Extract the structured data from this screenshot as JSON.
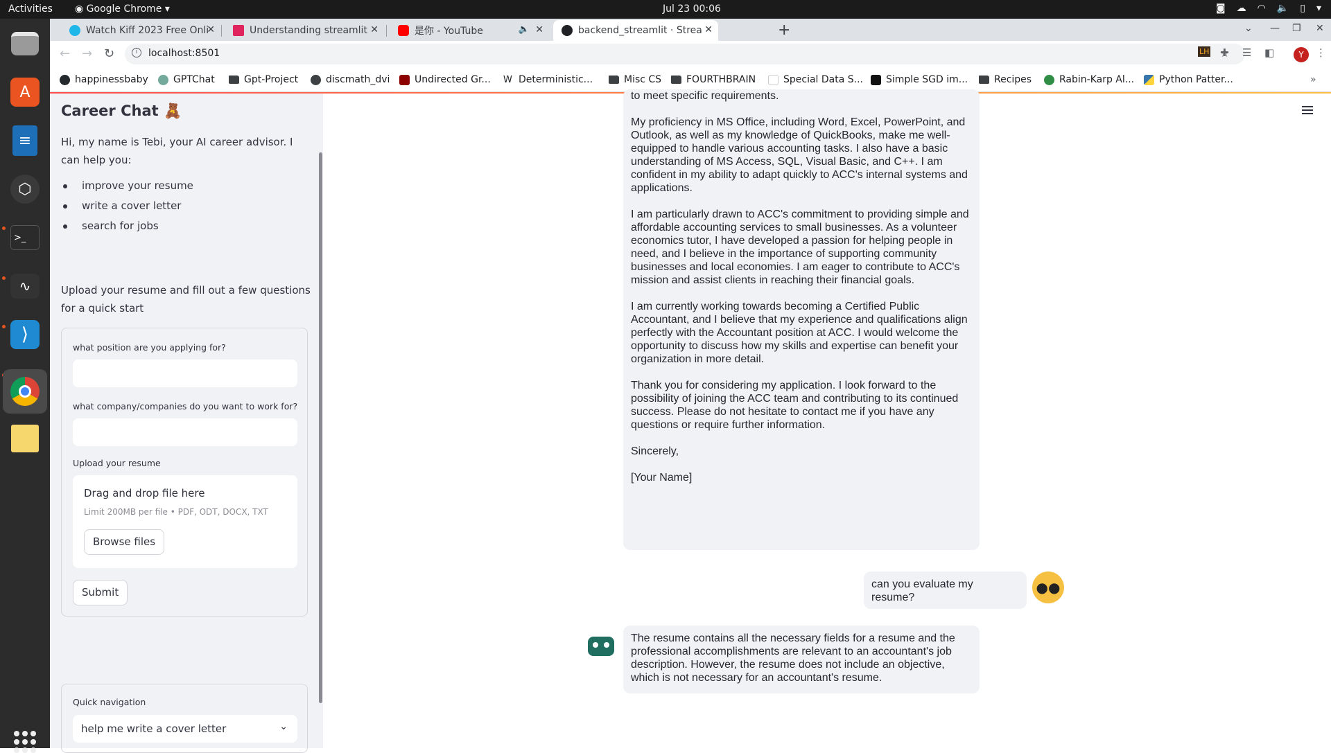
{
  "os": {
    "activities": "Activities",
    "app_name": "Google Chrome",
    "clock": "Jul 23  00:06"
  },
  "browser": {
    "tabs": [
      {
        "title": "Watch Kiff 2023 Free Onli",
        "favicon_color": "#1fb6e8"
      },
      {
        "title": "Understanding streamlit",
        "favicon_color": "#e0245e"
      },
      {
        "title": "是你 - YouTube",
        "favicon_color": "#ff0000"
      },
      {
        "title": "backend_streamlit · Strea",
        "favicon_color": "#202124"
      }
    ],
    "url": "localhost:8501",
    "profile_initial": "Y",
    "bookmarks": [
      "happinessbaby",
      "GPTChat",
      "Gpt-Project",
      "discmath_dvi",
      "Undirected Gr...",
      "Deterministic...",
      "Misc CS",
      "FOURTHBRAIN",
      "Special Data S...",
      "Simple SGD im...",
      "Recipes",
      "Rabin-Karp Al...",
      "Python Patter..."
    ]
  },
  "sidebar": {
    "title": "Career Chat 🧸",
    "intro": "Hi, my name is Tebi, your AI career advisor. I can help you:",
    "items": [
      "improve your resume",
      "write a cover letter",
      "search for jobs"
    ],
    "upload_prompt": "Upload your resume and fill out a few questions for a quick start",
    "form": {
      "position_label": "what position are you applying for?",
      "position_value": "",
      "company_label": "what company/companies do you want to work for?",
      "company_value": "",
      "resume_label": "Upload your resume",
      "dropzone_title": "Drag and drop file here",
      "dropzone_limit": "Limit 200MB per file • PDF, ODT, DOCX, TXT",
      "browse_label": "Browse files",
      "submit_label": "Submit"
    },
    "quick_nav": {
      "label": "Quick navigation",
      "selected": "help me write a cover letter"
    }
  },
  "chat": {
    "letter_paragraphs": [
      "to meet specific requirements.",
      "My proficiency in MS Office, including Word, Excel, PowerPoint, and\nOutlook, as well as my knowledge of QuickBooks, make me well-\nequipped to handle various accounting tasks. I also have a basic\nunderstanding of MS Access, SQL, Visual Basic, and C++. I am\nconfident in my ability to adapt quickly to ACC's internal systems and\napplications.",
      "I am particularly drawn to ACC's commitment to providing simple and\naffordable accounting services to small businesses. As a volunteer\neconomics tutor, I have developed a passion for helping people in\nneed, and I believe in the importance of supporting community\nbusinesses and local economies. I am eager to contribute to ACC's\nmission and assist clients in reaching their financial goals.",
      "I am currently working towards becoming a Certified Public\nAccountant, and I believe that my experience and qualifications align\nperfectly with the Accountant position at ACC. I would welcome the\nopportunity to discuss how my skills and expertise can benefit your\norganization in more detail.",
      "Thank you for considering my application. I look forward to the\npossibility of joining the ACC team and contributing to its continued\nsuccess. Please do not hesitate to contact me if you have any\nquestions or require further information.",
      "Sincerely,",
      "[Your Name]"
    ],
    "user_message": "can you evaluate my resume?",
    "bot_message": "The resume contains all the necessary fields for a resume and the\nprofessional accomplishments are relevant to an accountant's job\ndescription. However, the resume does not include an objective,\nwhich is not necessary for an accountant's resume."
  }
}
